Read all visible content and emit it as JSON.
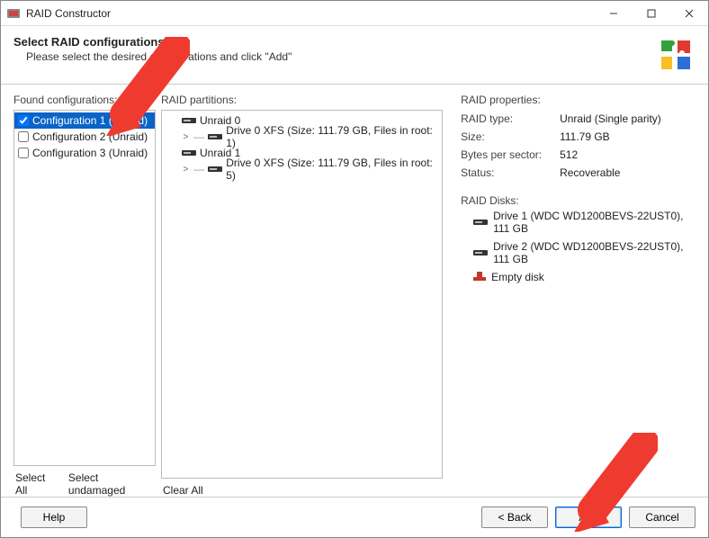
{
  "titlebar": {
    "title": "RAID Constructor"
  },
  "header": {
    "heading": "Select RAID configurations",
    "sub": "Please select the desired configurations and click \"Add\""
  },
  "labels": {
    "found": "Found configurations:",
    "partitions": "RAID partitions:",
    "properties": "RAID properties:",
    "disks_section": "RAID Disks:"
  },
  "configs": [
    {
      "label": "Configuration 1 (Unraid)",
      "checked": true,
      "selected": true
    },
    {
      "label": "Configuration 2 (Unraid)",
      "checked": false,
      "selected": false
    },
    {
      "label": "Configuration 3 (Unraid)",
      "checked": false,
      "selected": false
    }
  ],
  "config_links": {
    "select_all": "Select All",
    "select_undamaged": "Select undamaged",
    "clear_all": "Clear All"
  },
  "partitions": [
    {
      "depth": 0,
      "expander": "",
      "icon": "disk",
      "label": "Unraid 0"
    },
    {
      "depth": 1,
      "expander": ">",
      "icon": "disk",
      "label": "Drive 0 XFS (Size: 111.79 GB, Files in root: 1)"
    },
    {
      "depth": 0,
      "expander": "",
      "icon": "disk",
      "label": "Unraid 1"
    },
    {
      "depth": 1,
      "expander": ">",
      "icon": "disk",
      "label": "Drive 0 XFS (Size: 111.79 GB, Files in root: 5)"
    }
  ],
  "properties": {
    "type_label": "RAID type:",
    "type_value": "Unraid (Single parity)",
    "size_label": "Size:",
    "size_value": "111.79 GB",
    "bps_label": "Bytes per sector:",
    "bps_value": "512",
    "status_label": "Status:",
    "status_value": "Recoverable"
  },
  "disks": [
    {
      "icon": "disk",
      "label": "Drive 1 (WDC WD1200BEVS-22UST0), 111 GB"
    },
    {
      "icon": "disk",
      "label": "Drive 2 (WDC WD1200BEVS-22UST0), 111 GB"
    },
    {
      "icon": "empty",
      "label": "Empty disk"
    }
  ],
  "footer": {
    "help": "Help",
    "back": "< Back",
    "add": "Add",
    "cancel": "Cancel"
  }
}
